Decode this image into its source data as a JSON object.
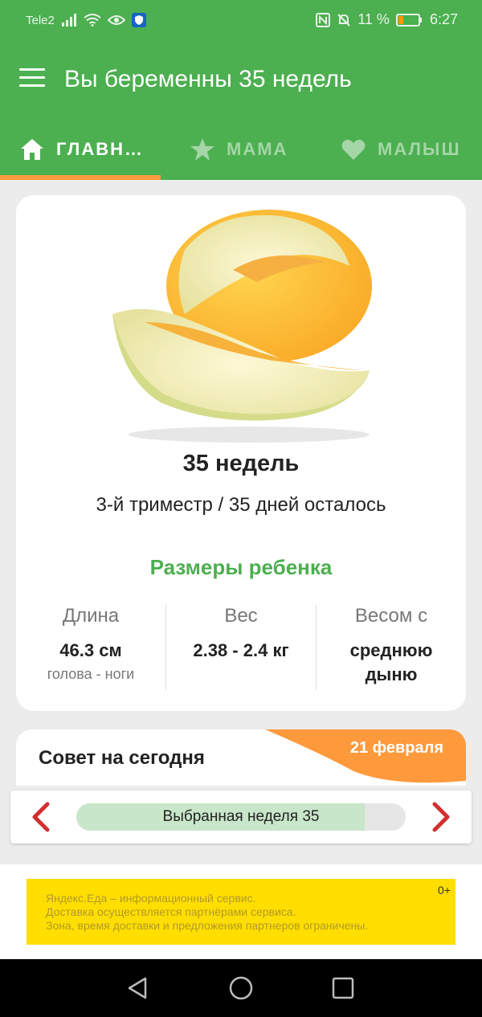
{
  "status_bar": {
    "carrier": "Tele2",
    "battery_percent": "11 %",
    "time": "6:27"
  },
  "app_bar": {
    "title": "Вы беременны 35 недель"
  },
  "tabs": [
    {
      "label": "ГЛАВН…",
      "icon": "home-icon",
      "active": true
    },
    {
      "label": "МАМА",
      "icon": "star-icon",
      "active": false
    },
    {
      "label": "МАЛЫШ",
      "icon": "heart-icon",
      "active": false
    }
  ],
  "week_card": {
    "image": "melon-image",
    "weeks": "35 недель",
    "trimester": "3-й триместр / 35 дней осталось",
    "sizes_title": "Размеры ребенка",
    "length": {
      "label": "Длина",
      "value": "46.3 см",
      "sub": "голова - ноги"
    },
    "weight": {
      "label": "Вес",
      "value": "2.38 - 2.4 кг"
    },
    "compare": {
      "label": "Весом с",
      "value": "среднюю дыню"
    }
  },
  "tip": {
    "title": "Совет на сегодня",
    "date": "21 февраля"
  },
  "week_selector": {
    "label": "Выбранная неделя 35",
    "progress_fraction": 0.875
  },
  "ad": {
    "lines": [
      "Яндекс.Еда – информационный сервис.",
      "Доставка осуществляется партнёрами сервиса.",
      "Зона, время доставки и предложения партнеров ограничены."
    ],
    "age": "0+"
  },
  "colors": {
    "primary": "#4caf50",
    "accent": "#ff9a3c",
    "arrow": "#d32f2f",
    "ad_bg": "#ffde00"
  }
}
